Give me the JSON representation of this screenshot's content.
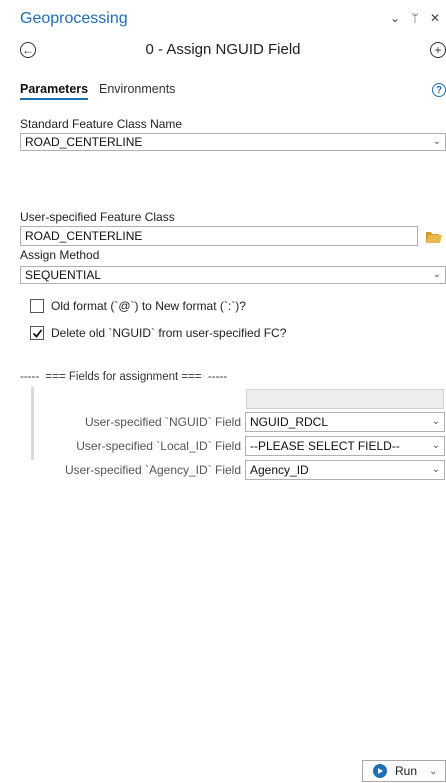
{
  "pane": {
    "title": "Geoprocessing",
    "controls": "⌄ ⫞ ✕"
  },
  "tool": {
    "title": "0 - Assign NGUID Field"
  },
  "tabs": {
    "parameters": "Parameters",
    "environments": "Environments"
  },
  "params": {
    "std_fc": {
      "label": "Standard Feature Class Name",
      "value": "ROAD_CENTERLINE"
    },
    "user_fc": {
      "label": "User-specified Feature Class",
      "value": "ROAD_CENTERLINE"
    },
    "method": {
      "label": "Assign Method",
      "value": "SEQUENTIAL"
    },
    "old_format": {
      "label": "Old format (`@`) to New format (`:`)?",
      "checked": false
    },
    "delete_old": {
      "label": "Delete old `NGUID` from user-specified FC?",
      "checked": true
    }
  },
  "fields_section": {
    "title": "-----  === Fields for assignment ===  -----",
    "rows": [
      {
        "label": "User-specified `NGUID` Field",
        "value": "NGUID_RDCL"
      },
      {
        "label": "User-specified `Local_ID` Field",
        "value": "--PLEASE SELECT FIELD--"
      },
      {
        "label": "User-specified `Agency_ID` Field",
        "value": "Agency_ID"
      }
    ]
  },
  "run": {
    "label": "Run"
  },
  "colors": {
    "accent": "#1f6fb5",
    "folder": "#e8b84a"
  }
}
